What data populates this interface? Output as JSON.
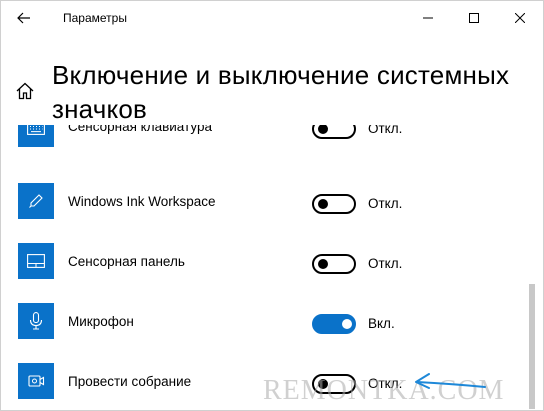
{
  "titlebar": {
    "title": "Параметры",
    "back_icon": "arrow-left-icon",
    "minimize_icon": "minimize-icon",
    "maximize_icon": "maximize-icon",
    "close_icon": "close-icon"
  },
  "nav": {
    "home_icon": "home-icon"
  },
  "page": {
    "title_line1": "Включение и выключение системных",
    "title_line2": "значков"
  },
  "items": [
    {
      "label": "Сенсорная клавиатура",
      "icon": "keyboard-icon",
      "state": "Откл.",
      "on": false
    },
    {
      "label": "Windows Ink Workspace",
      "icon": "pen-icon",
      "state": "Откл.",
      "on": false
    },
    {
      "label": "Сенсорная панель",
      "icon": "touchpad-icon",
      "state": "Откл.",
      "on": false
    },
    {
      "label": "Микрофон",
      "icon": "microphone-icon",
      "state": "Вкл.",
      "on": true
    },
    {
      "label": "Провести собрание",
      "icon": "meet-now-icon",
      "state": "Откл.",
      "on": false
    }
  ],
  "watermark": "REMONTKA.COM",
  "colors": {
    "accent": "#0a72c9",
    "annotation": "#1e88d8"
  }
}
